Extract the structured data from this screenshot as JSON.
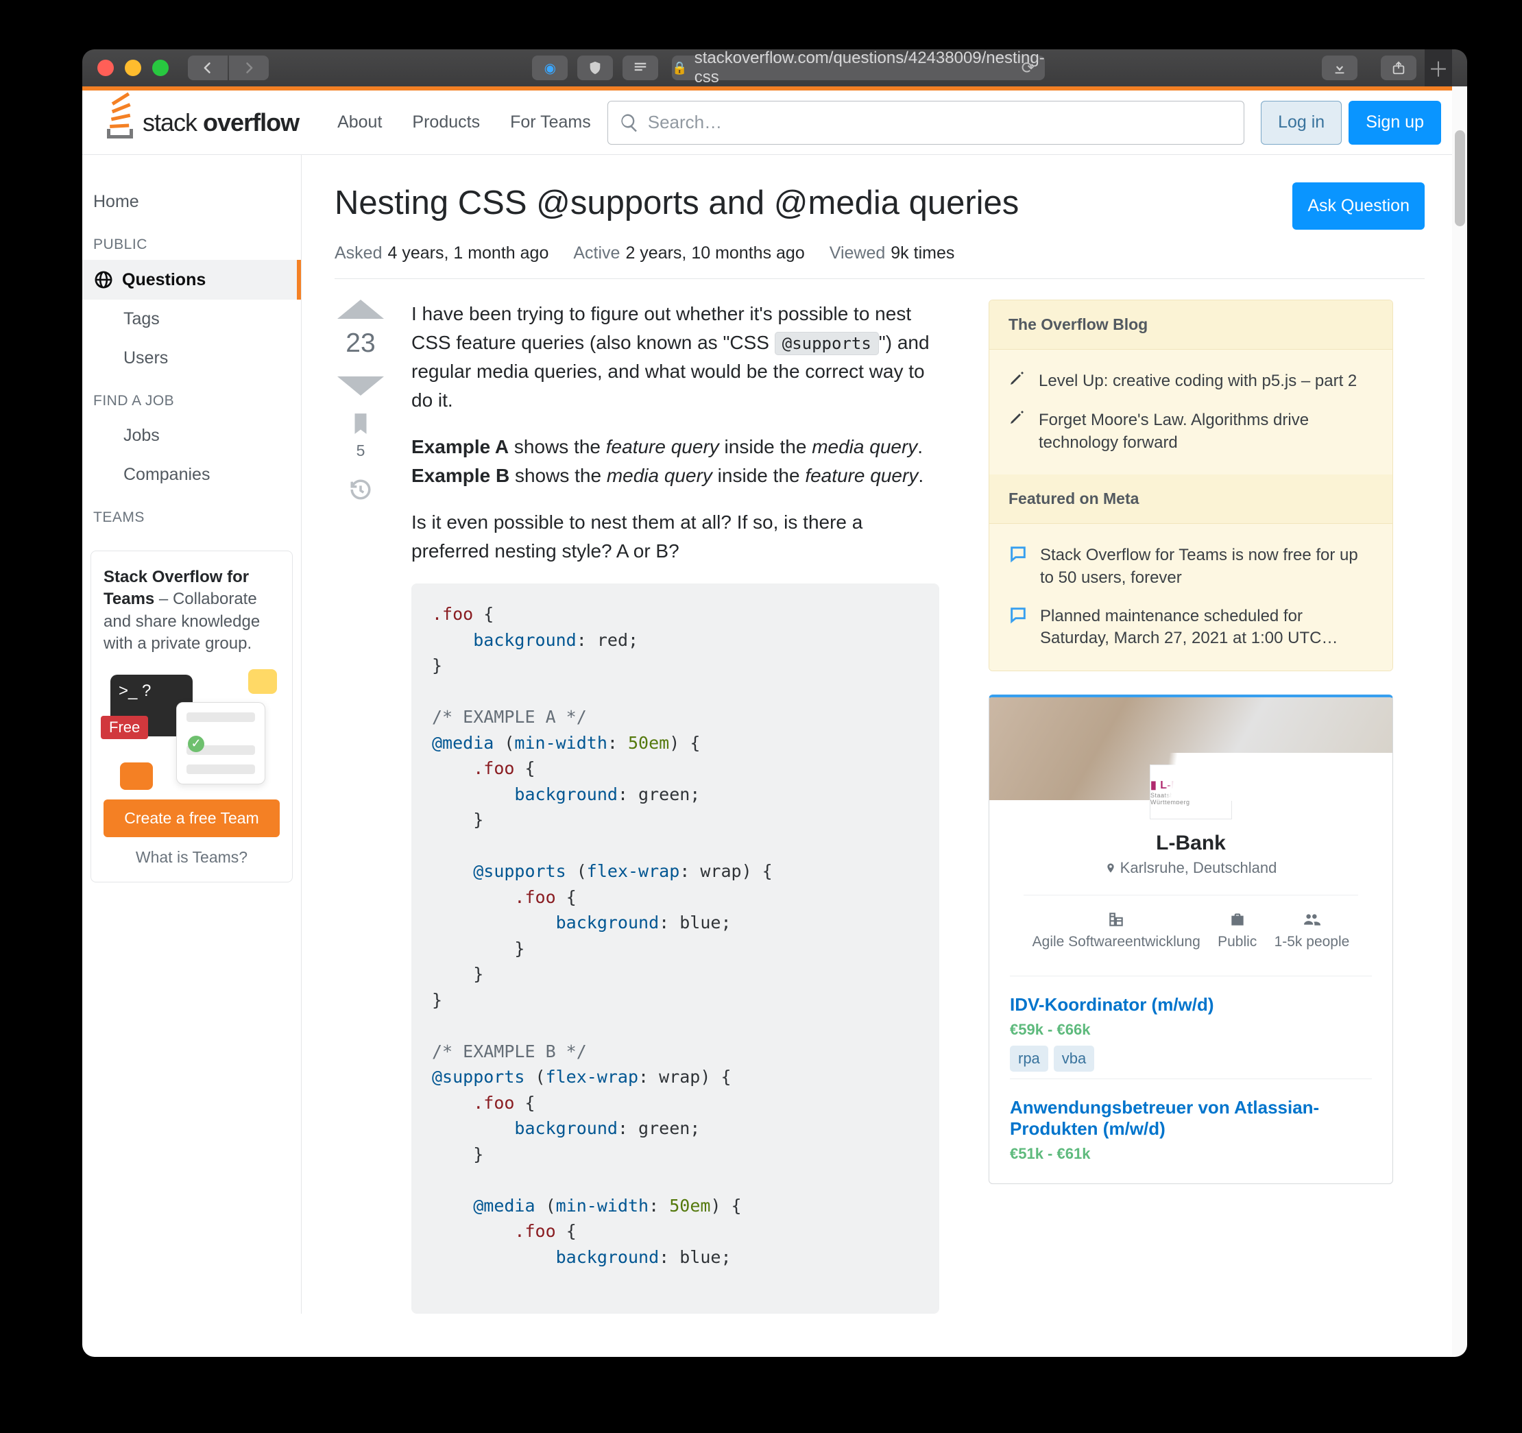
{
  "browser": {
    "url_display": "stackoverflow.com/questions/42438009/nesting-css"
  },
  "topbar": {
    "logo_light": "stack",
    "logo_bold": "overflow",
    "nav": [
      "About",
      "Products",
      "For Teams"
    ],
    "search_placeholder": "Search…",
    "login": "Log in",
    "signup": "Sign up"
  },
  "leftnav": {
    "home": "Home",
    "public_label": "PUBLIC",
    "questions": "Questions",
    "tags": "Tags",
    "users": "Users",
    "findjob_label": "FIND A JOB",
    "jobs": "Jobs",
    "companies": "Companies",
    "teams_label": "TEAMS",
    "teams_card_bold": "Stack Overflow for Teams",
    "teams_card_rest": " – Collaborate and share knowledge with a private group.",
    "teams_free": "Free",
    "teams_prompt": ">_ ?",
    "create_team": "Create a free Team",
    "what_is_teams": "What is Teams?"
  },
  "question": {
    "title": "Nesting CSS @supports and @media queries",
    "ask_btn": "Ask Question",
    "meta": {
      "asked_k": "Asked",
      "asked_v": "4 years, 1 month ago",
      "active_k": "Active",
      "active_v": "2 years, 10 months ago",
      "viewed_k": "Viewed",
      "viewed_v": "9k times"
    },
    "score": "23",
    "bookmark_count": "5",
    "body": {
      "p1a": "I have been trying to figure out whether it's possible to nest CSS feature queries (also known as \"CSS ",
      "p1_code": "@supports",
      "p1b": "\") and regular media queries, and what would be the correct way to do it.",
      "p2_exA_b": "Example A",
      "p2_exA_t1": " shows the ",
      "p2_exA_em1": "feature query",
      "p2_exA_t2": " inside the ",
      "p2_exA_em2": "media query",
      "p2_exA_t3": ".",
      "p2_exB_b": "Example B",
      "p2_exB_t1": " shows the ",
      "p2_exB_em1": "media query",
      "p2_exB_t2": " inside the ",
      "p2_exB_em2": "feature query",
      "p2_exB_t3": ".",
      "p3": "Is it even possible to nest them at all? If so, is there a preferred nesting style? A or B?"
    }
  },
  "sidebar": {
    "blog_head": "The Overflow Blog",
    "blog": [
      "Level Up: creative coding with p5.js – part 2",
      "Forget Moore's Law. Algorithms drive technology forward"
    ],
    "meta_head": "Featured on Meta",
    "meta": [
      "Stack Overflow for Teams is now free for up to 50 users, forever",
      "Planned maintenance scheduled for Saturday, March 27, 2021 at 1:00 UTC…"
    ]
  },
  "ad": {
    "logo_text": "▮ L-BANK",
    "logo_sub": "Staatsbank für Baden-Württemberg",
    "name": "L-Bank",
    "location": "Karlsruhe, Deutschland",
    "stats": {
      "a": "Agile Softwareentwicklung",
      "b": "Public",
      "c": "1-5k people"
    },
    "jobs": [
      {
        "title": "IDV-Koordinator (m/w/d)",
        "salary": "€59k - €66k",
        "tags": [
          "rpa",
          "vba"
        ]
      },
      {
        "title": "Anwendungsbetreuer von Atlassian-Produkten (m/w/d)",
        "salary": "€51k - €61k",
        "tags": []
      }
    ]
  }
}
